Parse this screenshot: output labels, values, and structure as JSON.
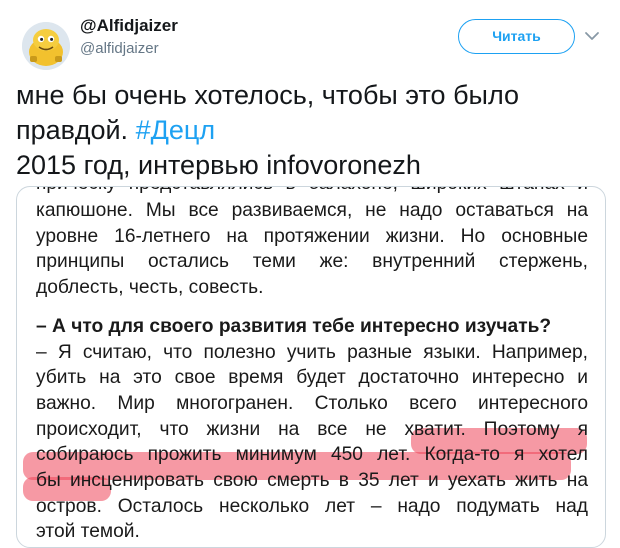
{
  "header": {
    "display_name": "@Alfidjaizer",
    "username": "@alfidjaizer",
    "follow_label": "Читать"
  },
  "tweet": {
    "text_part1": "мне бы очень хотелось, чтобы это было правдой. ",
    "hashtag": "#Децл",
    "text_part2": "2015 год, интервью infovoronezh"
  },
  "article": {
    "line_0": "прическу представлялись в балахоне, широких штанах и",
    "line_1": "капюшоне. Мы все развиваемся, не надо оставаться на",
    "line_2": "уровне 16-летнего на протяжении жизни. Но основные",
    "line_3": "принципы остались теми же: внутренний стержень,",
    "line_4": "доблесть, честь, совесть.",
    "question": "– А что для своего развития тебе интересно изучать?",
    "line_5": "– Я считаю, что полезно учить разные языки. Например,",
    "line_6": "убить на это свое время будет достаточно интересно и",
    "line_7": "важно. Мир многогранен. Столько всего интересного",
    "line_8": "происходит, что жизни на все не хватит. Поэтому я",
    "line_9": "собираюсь прожить минимум 450 лет. Когда-то я хотел",
    "line_10": "бы инсценировать свою смерть в 35 лет и уехать жить на",
    "line_11": "остров. Осталось несколько лет – надо подумать над",
    "line_12": "этой темой."
  },
  "colors": {
    "accent": "#1da1f2",
    "highlight": "#ef465a"
  },
  "icons": {
    "avatar": "avatar-image",
    "chevron": "chevron-down-icon"
  }
}
